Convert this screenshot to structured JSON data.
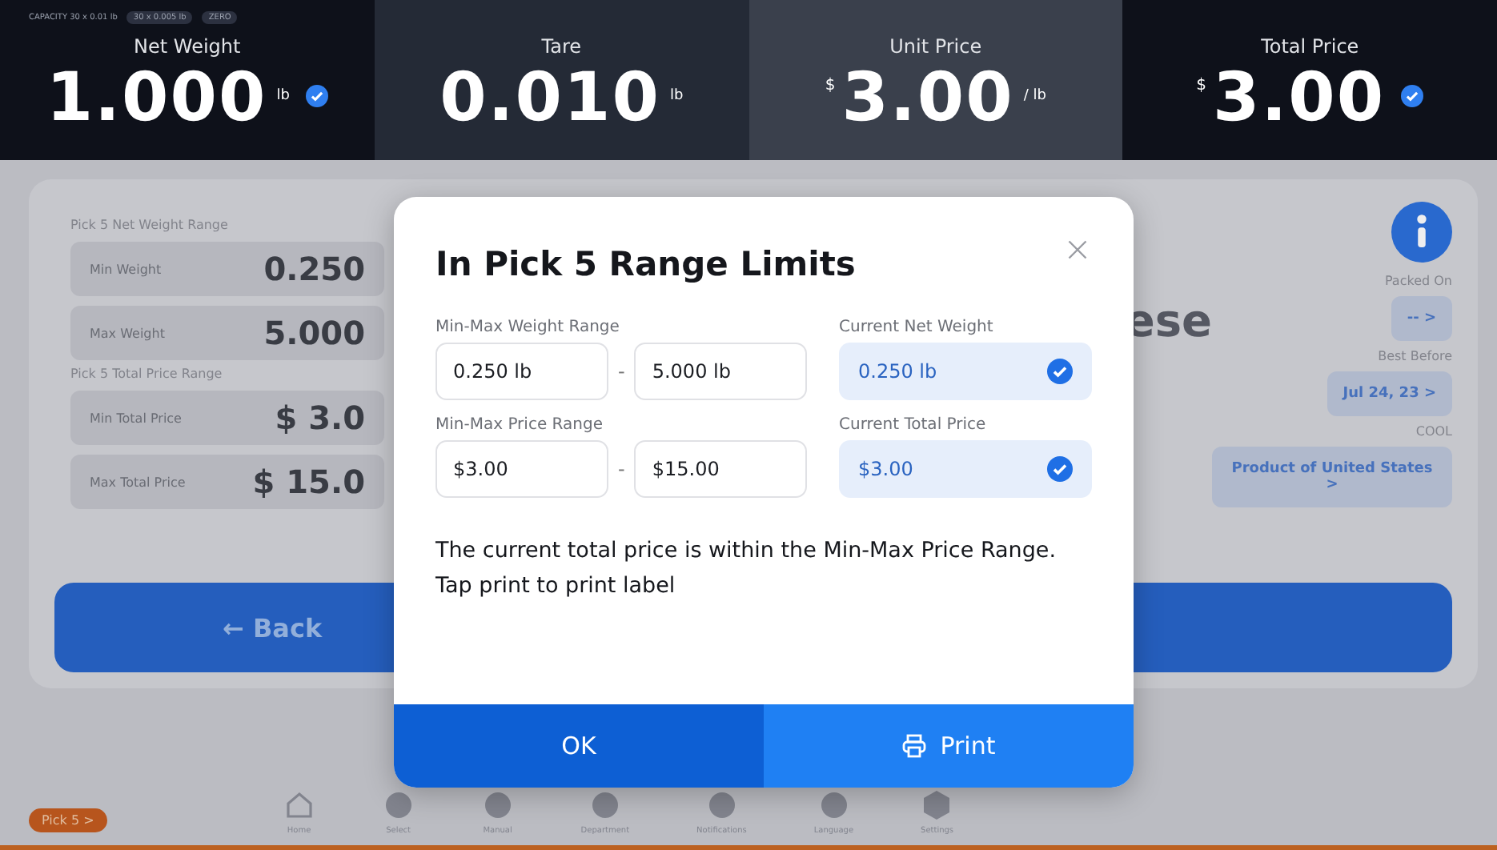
{
  "header": {
    "capacity_tags": [
      {
        "text": "CAPACITY  30 x 0.01 lb",
        "boxed": false
      },
      {
        "text": "30 x 0.005 lb",
        "boxed": true
      },
      {
        "text": "ZERO",
        "boxed": true
      }
    ],
    "tiles": [
      {
        "label": "Net Weight",
        "value": "1.000",
        "unit": "lb",
        "verified": true,
        "selected": false
      },
      {
        "label": "Tare",
        "value": "0.010",
        "unit": "lb",
        "verified": false,
        "selected": false
      },
      {
        "label": "Unit Price",
        "prefix": "$",
        "value": "3.00",
        "unit": "/ lb",
        "verified": false,
        "selected": true
      },
      {
        "label": "Total Price",
        "prefix": "$",
        "value": "3.00",
        "verified": true,
        "selected": false
      }
    ]
  },
  "background": {
    "groups": [
      {
        "title": "Pick 5 Net Weight Range",
        "rows": [
          {
            "label": "Min Weight",
            "value": "0.250"
          },
          {
            "label": "Max Weight",
            "value": "5.000"
          }
        ]
      },
      {
        "title": "Pick 5 Total Price Range",
        "rows": [
          {
            "label": "Min Total Price",
            "value": "$ 3.0"
          },
          {
            "label": "Max Total Price",
            "value": "$ 15.0"
          }
        ]
      }
    ],
    "product_name": "ese",
    "fields": [
      {
        "label": "Packed On",
        "value": "-- >"
      },
      {
        "label": "Best Before",
        "value": "Jul 24, 23 >"
      },
      {
        "label": "COOL",
        "value": "Product of United States >"
      }
    ],
    "back_button": "← Back",
    "nav": [
      {
        "label": "Home",
        "kind": "home"
      },
      {
        "label": "Select",
        "kind": "generic"
      },
      {
        "label": "Manual",
        "kind": "generic"
      },
      {
        "label": "Department",
        "kind": "generic"
      },
      {
        "label": "Notifications",
        "kind": "generic"
      },
      {
        "label": "Language",
        "kind": "generic"
      },
      {
        "label": "Settings",
        "kind": "settings"
      }
    ],
    "mode_badge": "Pick 5 >"
  },
  "dialog": {
    "title": "In Pick 5 Range Limits",
    "rows": [
      {
        "range_label": "Min-Max Weight Range",
        "min": "0.250 lb",
        "max": "5.000 lb",
        "separator": "-",
        "current_label": "Current Net Weight",
        "current_value": "0.250 lb",
        "ok": true
      },
      {
        "range_label": "Min-Max Price Range",
        "min": "$3.00",
        "max": "$15.00",
        "separator": "-",
        "current_label": "Current Total Price",
        "current_value": "$3.00",
        "ok": true
      }
    ],
    "message": "The current total price is within the Min-Max Price Range. Tap print to print label",
    "ok_button": "OK",
    "print_button": "Print"
  }
}
